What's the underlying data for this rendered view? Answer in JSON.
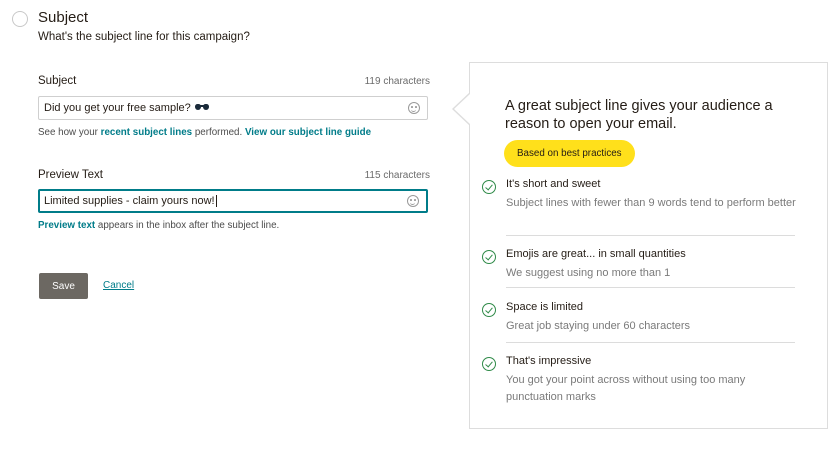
{
  "header": {
    "title": "Subject",
    "subtitle": "What's the subject line for this campaign?"
  },
  "subject_field": {
    "label": "Subject",
    "char_count": "119 characters",
    "value": "Did you get your free sample?",
    "emoji": "sunglasses",
    "helper_prefix": "See how your ",
    "helper_link1": "recent subject lines",
    "helper_middle": " performed. ",
    "helper_link2": "View our subject line guide"
  },
  "preview_field": {
    "label": "Preview Text",
    "char_count": "115 characters",
    "value": "Limited supplies - claim yours now!",
    "helper_link": "Preview text",
    "helper_suffix": " appears in the inbox after the subject line."
  },
  "actions": {
    "save_label": "Save",
    "cancel_label": "Cancel"
  },
  "tips_panel": {
    "heading": "A great subject line gives your audience a reason to open your email.",
    "badge": "Based on best practices",
    "items": [
      {
        "title": "It's short and sweet",
        "description": "Subject lines with fewer than 9 words tend to perform better"
      },
      {
        "title": "Emojis are great... in small quantities",
        "description": "We suggest using no more than 1"
      },
      {
        "title": "Space is limited",
        "description": "Great job staying under 60 characters"
      },
      {
        "title": "That's impressive",
        "description": "You got your point across without using too many punctuation marks"
      }
    ]
  },
  "colors": {
    "accent": "#007c89",
    "badge": "#ffe01b",
    "check": "#2f8a48",
    "save_button": "#6c6862"
  }
}
